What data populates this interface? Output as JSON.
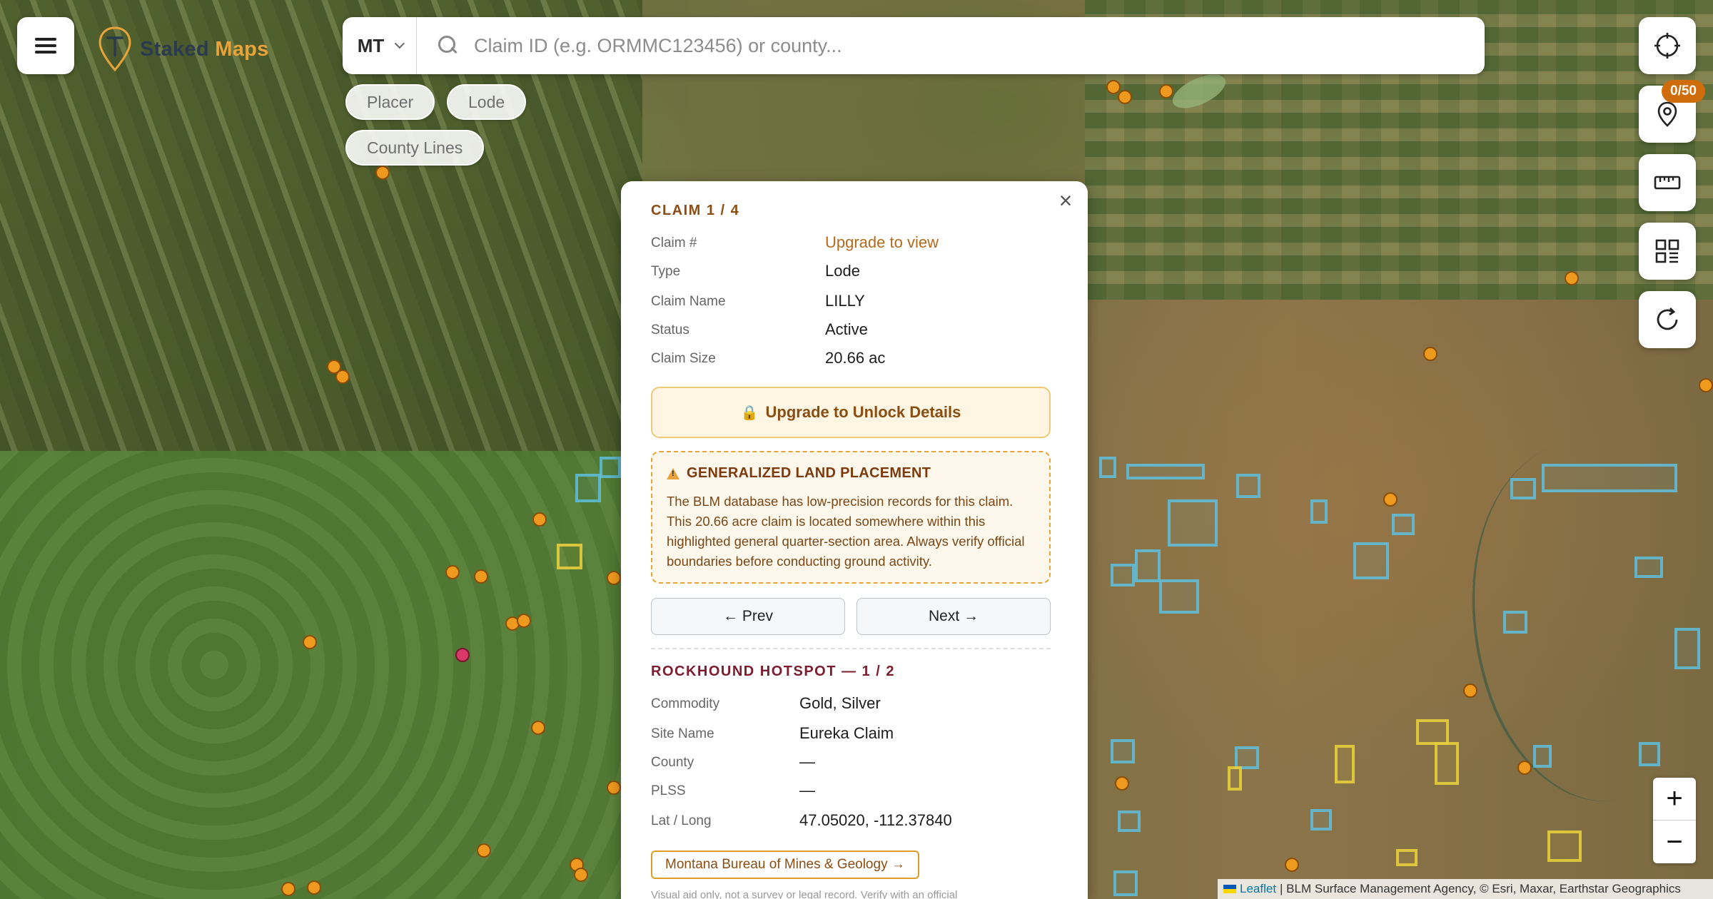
{
  "app": {
    "name_part1": "Staked",
    "name_part2": "Maps"
  },
  "search": {
    "state": "MT",
    "placeholder": "Claim ID (e.g. ORMMC123456) or county..."
  },
  "filters": {
    "placer": "Placer",
    "lode": "Lode",
    "county_lines": "County Lines"
  },
  "tools": {
    "saved_badge": "0/50"
  },
  "zoom": {
    "in": "+",
    "out": "−"
  },
  "attribution": {
    "leaflet": "Leaflet",
    "text": "| BLM Surface Management Agency, © Esri, Maxar, Earthstar Geographics"
  },
  "popup": {
    "close": "×",
    "claim_title": "CLAIM 1 / 4",
    "claim_fields": [
      {
        "label": "Claim #",
        "value": "Upgrade to view"
      },
      {
        "label": "Type",
        "value": "Lode"
      },
      {
        "label": "Claim Name",
        "value": "LILLY"
      },
      {
        "label": "Status",
        "value": "Active"
      },
      {
        "label": "Claim Size",
        "value": "20.66 ac"
      }
    ],
    "upgrade_label": "Upgrade to Unlock Details",
    "warning_title": "GENERALIZED LAND PLACEMENT",
    "warning_text": "The BLM database has low-precision records for this claim. This 20.66 acre claim is located somewhere within this highlighted general quarter-section area. Always verify official boundaries before conducting ground activity.",
    "prev_label": "← Prev",
    "next_label": "Next →",
    "hotspot_title": "ROCKHOUND HOTSPOT — 1 / 2",
    "hotspot_fields": [
      {
        "label": "Commodity",
        "value": "Gold, Silver"
      },
      {
        "label": "Site Name",
        "value": "Eureka Claim"
      },
      {
        "label": "County",
        "value": "—"
      },
      {
        "label": "PLSS",
        "value": "—"
      },
      {
        "label": "Lat / Long",
        "value": "47.05020, -112.37840"
      }
    ],
    "mbmg_link": "Montana Bureau of Mines & Geology →",
    "footnote": "Visual aid only, not a survey or legal record. Verify with an official"
  },
  "colors": {
    "accent": "#e8a33a",
    "brand_dark": "#2c3a4f",
    "claim_title": "#8b4d12",
    "hotspot_title": "#7b1c2f"
  }
}
